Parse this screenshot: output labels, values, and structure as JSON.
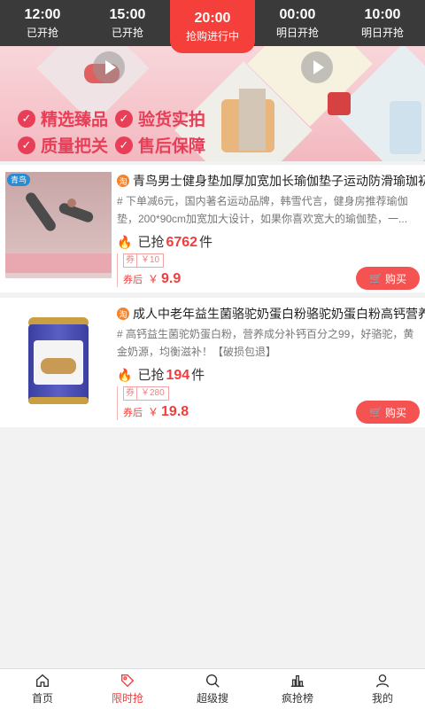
{
  "time_tabs": [
    {
      "time": "12:00",
      "status": "已开抢",
      "active": false
    },
    {
      "time": "15:00",
      "status": "已开抢",
      "active": false
    },
    {
      "time": "20:00",
      "status": "抢购进行中",
      "active": true
    },
    {
      "time": "00:00",
      "status": "明日开抢",
      "active": false
    },
    {
      "time": "10:00",
      "status": "明日开抢",
      "active": false
    }
  ],
  "banner": {
    "features": [
      "精选臻品",
      "验货实拍",
      "质量把关",
      "售后保障"
    ],
    "check_icon": "check-circle-icon",
    "play_icon": "play-icon"
  },
  "products": [
    {
      "platform_icon": "taobao-icon",
      "thumb_brand": "青鸟",
      "title": "青鸟男士健身垫加厚加宽加长瑜伽垫子运动防滑瑜珈初",
      "desc": "# 下单减6元，国内著名运动品牌，韩雪代言，健身房推荐瑜伽垫，200*90cm加宽加大设计，如果你喜欢宽大的瑜伽垫，一...",
      "sold_label": "已抢",
      "sold_count": "6762",
      "sold_unit": "件",
      "coupon_label": "券",
      "coupon_value": "￥10",
      "after_label": "券后",
      "currency": "￥",
      "price": "9.9",
      "buy_label": "购买"
    },
    {
      "platform_icon": "taobao-icon",
      "title": "成人中老年益生菌骆驼奶蛋白粉骆驼奶蛋白粉高钙营养",
      "desc": "# 高钙益生菌驼奶蛋白粉，营养成分补钙百分之99，好骆驼，黄金奶源，均衡滋补！【破损包退】",
      "sold_label": "已抢",
      "sold_count": "194",
      "sold_unit": "件",
      "coupon_label": "券",
      "coupon_value": "￥280",
      "after_label": "券后",
      "currency": "￥",
      "price": "19.8",
      "buy_label": "购买"
    }
  ],
  "bottom_nav": [
    {
      "label": "首页",
      "icon": "home-icon",
      "active": false
    },
    {
      "label": "限时抢",
      "icon": "flash-sale-tag-icon",
      "active": true
    },
    {
      "label": "超级搜",
      "icon": "search-icon",
      "active": false
    },
    {
      "label": "疯抢榜",
      "icon": "ranking-icon",
      "active": false
    },
    {
      "label": "我的",
      "icon": "user-icon",
      "active": false
    }
  ],
  "colors": {
    "accent": "#f43f3a",
    "time_bar_bg": "#3a3a3a",
    "banner_text": "#e83e57",
    "price_red": "#f03d3d",
    "buy_button": "#f55252"
  }
}
